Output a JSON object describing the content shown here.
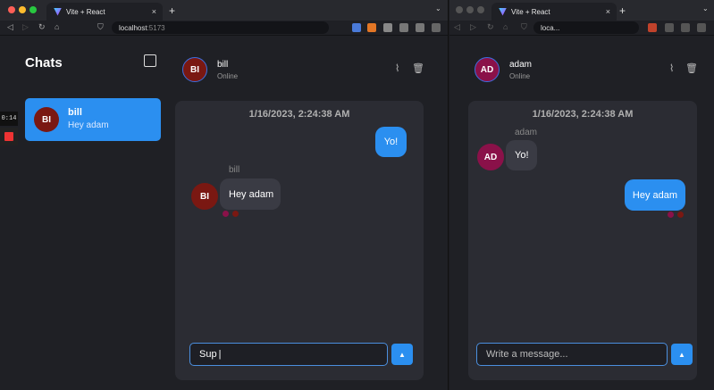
{
  "left_browser": {
    "tab_title": "Vite + React",
    "url_host": "localhost",
    "url_port": ":5173",
    "sidebar": {
      "title": "Chats",
      "chat_items": [
        {
          "initials": "BI",
          "name": "bill",
          "preview": "Hey adam"
        }
      ]
    },
    "recorder": {
      "timer": "0:14"
    },
    "chat": {
      "contact_initials": "BI",
      "contact_name": "bill",
      "contact_status": "Online",
      "timestamp": "1/16/2023, 2:24:38 AM",
      "messages": [
        {
          "direction": "out",
          "text": "Yo!"
        },
        {
          "direction": "in",
          "sender": "bill",
          "initials": "BI",
          "text": "Hey adam"
        }
      ],
      "input_value": "Sup"
    }
  },
  "right_browser": {
    "tab_title": "Vite + React",
    "url_host": "loca...",
    "chat": {
      "contact_initials": "AD",
      "contact_name": "adam",
      "contact_status": "Online",
      "timestamp": "1/16/2023, 2:24:38 AM",
      "messages": [
        {
          "direction": "in",
          "sender": "adam",
          "initials": "AD",
          "text": "Yo!"
        },
        {
          "direction": "out",
          "text": "Hey adam"
        }
      ],
      "input_placeholder": "Write a message..."
    }
  },
  "icons": {
    "close": "×",
    "new_tab": "+",
    "chevron": "⌄",
    "back": "◁",
    "forward": "▷",
    "reload": "↻",
    "home": "⌂",
    "bookmark": "⛉",
    "attach": "⌇",
    "trash": "🗑",
    "send": "▲"
  },
  "colors": {
    "accent": "#2b8ff0",
    "bill_avatar": "#7a1812",
    "adam_avatar": "#8a1149",
    "background": "#1f2025",
    "panel": "#2b2c33"
  }
}
